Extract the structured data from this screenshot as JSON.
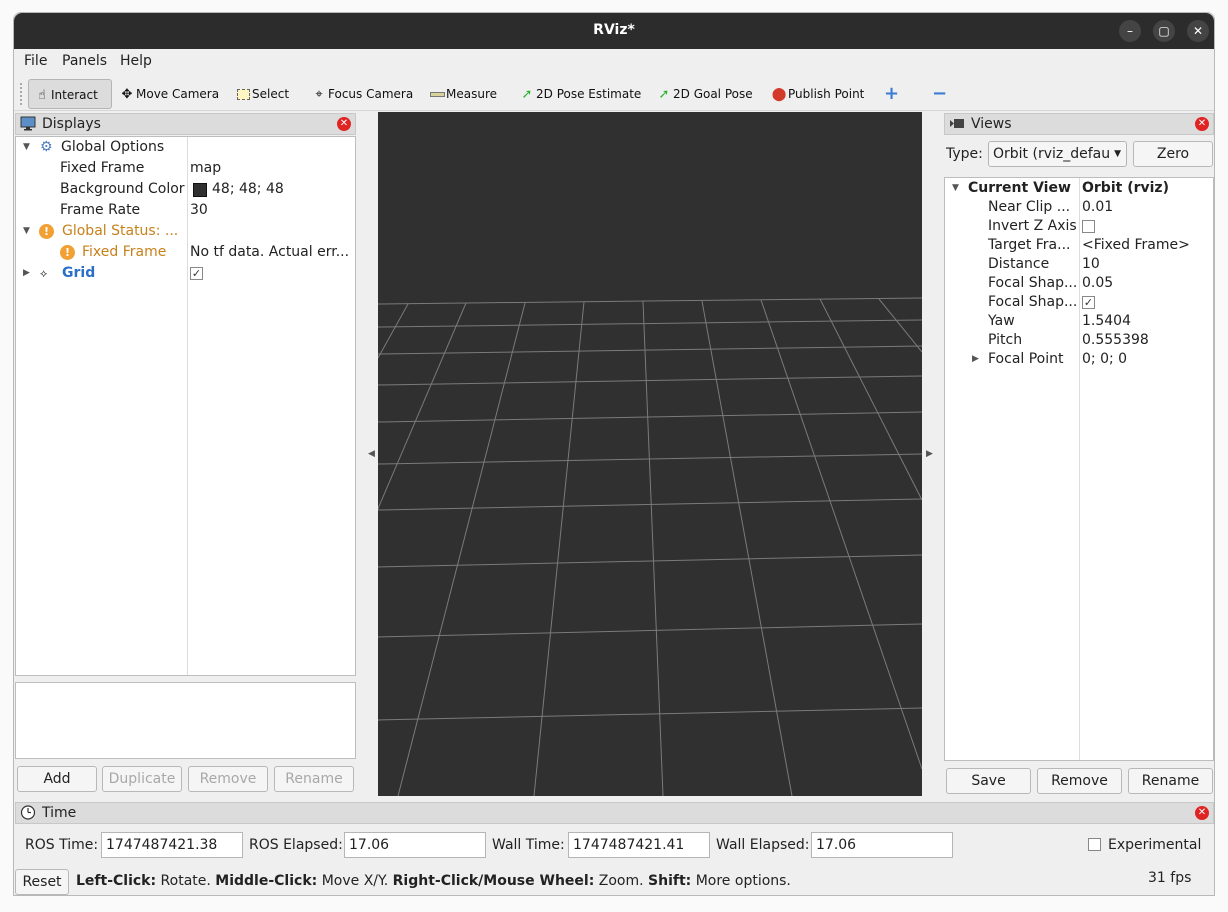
{
  "window": {
    "title": "RViz*"
  },
  "menu": [
    "File",
    "Panels",
    "Help"
  ],
  "toolbar": {
    "tools": [
      {
        "label": "Interact",
        "icon": "hand-icon"
      },
      {
        "label": "Move Camera",
        "icon": "move-camera-icon"
      },
      {
        "label": "Select",
        "icon": "select-icon"
      },
      {
        "label": "Focus Camera",
        "icon": "focus-camera-icon"
      },
      {
        "label": "Measure",
        "icon": "ruler-icon"
      },
      {
        "label": "2D Pose Estimate",
        "icon": "green-arrow-icon"
      },
      {
        "label": "2D Goal Pose",
        "icon": "green-arrow-icon"
      },
      {
        "label": "Publish Point",
        "icon": "map-pin-icon"
      }
    ],
    "add_symbol": "+",
    "remove_symbol": "−"
  },
  "displays": {
    "title": "Displays",
    "rows": {
      "global_options": "Global Options",
      "fixed_frame_label": "Fixed Frame",
      "fixed_frame_value": "map",
      "bg_color_label": "Background Color",
      "bg_color_value": "48; 48; 48",
      "bg_color_swatch": "#303030",
      "frame_rate_label": "Frame Rate",
      "frame_rate_value": "30",
      "global_status_label": "Global Status: ...",
      "status_fixed_frame_label": "Fixed Frame",
      "status_fixed_frame_value": "No tf data.  Actual err...",
      "grid_label": "Grid",
      "grid_checked": "✓"
    },
    "buttons": {
      "add": "Add",
      "duplicate": "Duplicate",
      "remove": "Remove",
      "rename": "Rename"
    }
  },
  "views": {
    "title": "Views",
    "type_label": "Type:",
    "type_value": "Orbit (rviz_defau",
    "zero_label": "Zero",
    "current_view_label": "Current View",
    "current_view_value": "Orbit (rviz)",
    "props": [
      {
        "label": "Near Clip ...",
        "value": "0.01"
      },
      {
        "label": "Invert Z Axis",
        "value": ""
      },
      {
        "label": "Target Fra...",
        "value": "<Fixed Frame>"
      },
      {
        "label": "Distance",
        "value": "10"
      },
      {
        "label": "Focal Shap...",
        "value": "0.05"
      },
      {
        "label": "Focal Shap...",
        "value": "✓"
      },
      {
        "label": "Yaw",
        "value": "1.5404"
      },
      {
        "label": "Pitch",
        "value": "0.555398"
      },
      {
        "label": "Focal Point",
        "value": "0; 0; 0"
      }
    ],
    "buttons": {
      "save": "Save",
      "remove": "Remove",
      "rename": "Rename"
    }
  },
  "time": {
    "title": "Time",
    "ros_time_label": "ROS Time:",
    "ros_time_value": "1747487421.38",
    "ros_elapsed_label": "ROS Elapsed:",
    "ros_elapsed_value": "17.06",
    "wall_time_label": "Wall Time:",
    "wall_time_value": "1747487421.41",
    "wall_elapsed_label": "Wall Elapsed:",
    "wall_elapsed_value": "17.06",
    "experimental_label": "Experimental"
  },
  "statusbar": {
    "reset_label": "Reset",
    "hint_left_b": "Left-Click:",
    "hint_left": " Rotate. ",
    "hint_middle_b": "Middle-Click:",
    "hint_middle": " Move X/Y. ",
    "hint_right_b": "Right-Click/Mouse Wheel:",
    "hint_right": " Zoom. ",
    "hint_shift_b": "Shift:",
    "hint_shift": " More options.",
    "fps": "31 fps"
  }
}
